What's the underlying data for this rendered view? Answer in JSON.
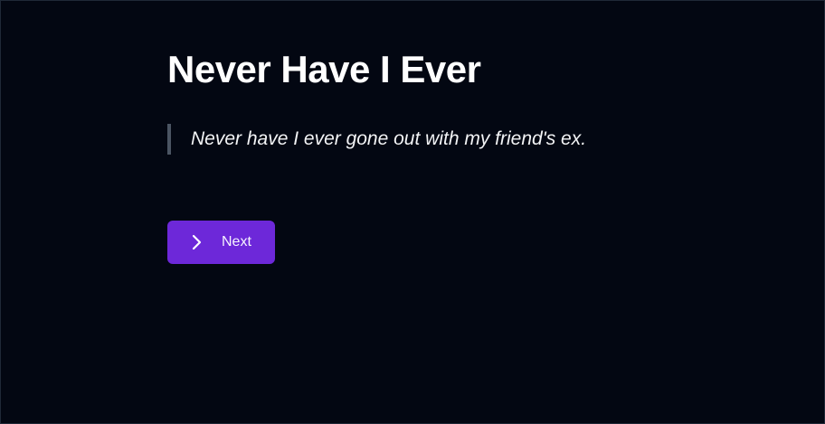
{
  "game": {
    "title": "Never Have I Ever",
    "statement": "Never have I ever gone out with my friend's ex."
  },
  "controls": {
    "next_label": "Next",
    "next_icon": "chevron-right-icon"
  },
  "colors": {
    "background": "#030712",
    "button": "#6d28d9",
    "quote_border": "#4b5563",
    "text": "#ffffff"
  }
}
